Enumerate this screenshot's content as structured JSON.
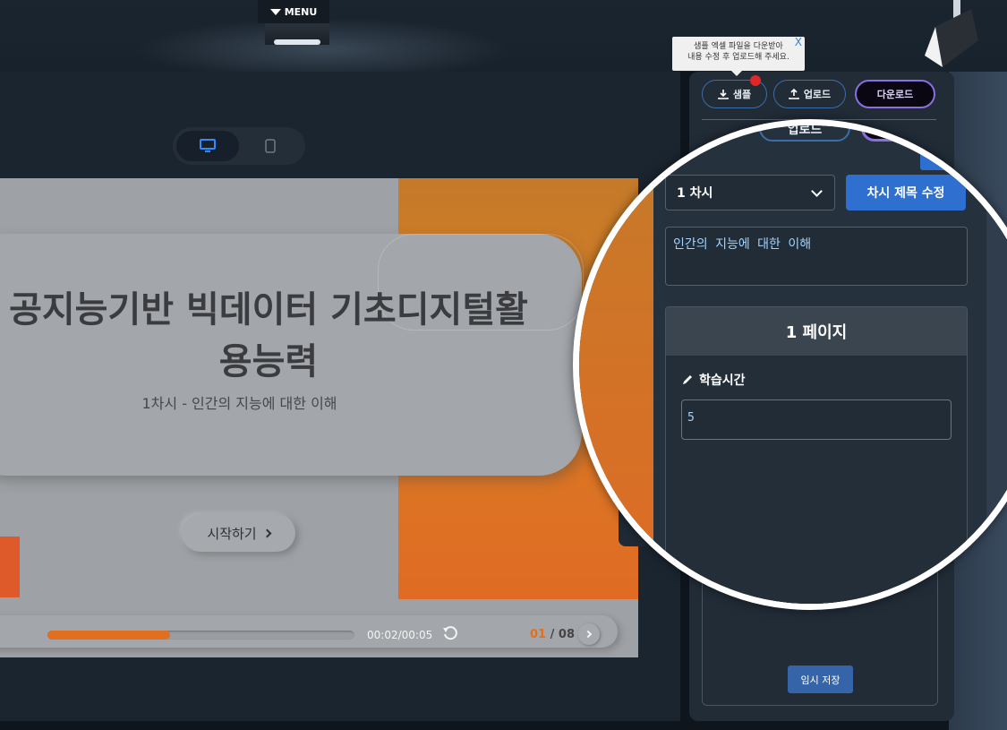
{
  "header": {
    "menu_label": "MENU"
  },
  "device_toggle": {
    "options": [
      "desktop-icon",
      "mobile-icon"
    ],
    "active": "desktop"
  },
  "slide": {
    "title_line1": "공지능기반 빅데이터 기초디지털활",
    "title_line2": "용능력",
    "subtitle": "1차시 - 인간의 지능에 대한 이해",
    "start_button": "시작하기",
    "player": {
      "progress_percent": 40,
      "time": "00:02/00:05",
      "current_page": "01",
      "separator": " / ",
      "total_pages": "08"
    }
  },
  "editor": {
    "tooltip_line1": "샘플 엑셀 파일을 다운받아",
    "tooltip_line2": "내용 수정 후 업로드해 주세요.",
    "tooltip_close": "X",
    "sample_button": "샘플",
    "upload_button": "업로드",
    "download_button": "다운로드",
    "chasi_select_value": "1 차시",
    "chasi_edit_button": "차시 제목 수정",
    "chasi_title_value": "인간의 지능에 대한 이해",
    "page_header": "1 페이지",
    "study_time_label": "학습시간",
    "study_time_value": "5",
    "temp_save_button": "임시 저장",
    "ghost_upload_label": "업로드"
  },
  "colors": {
    "accent_orange": "#e0701f",
    "accent_blue": "#2f6fd0",
    "download_purple": "#8a6fe0"
  }
}
